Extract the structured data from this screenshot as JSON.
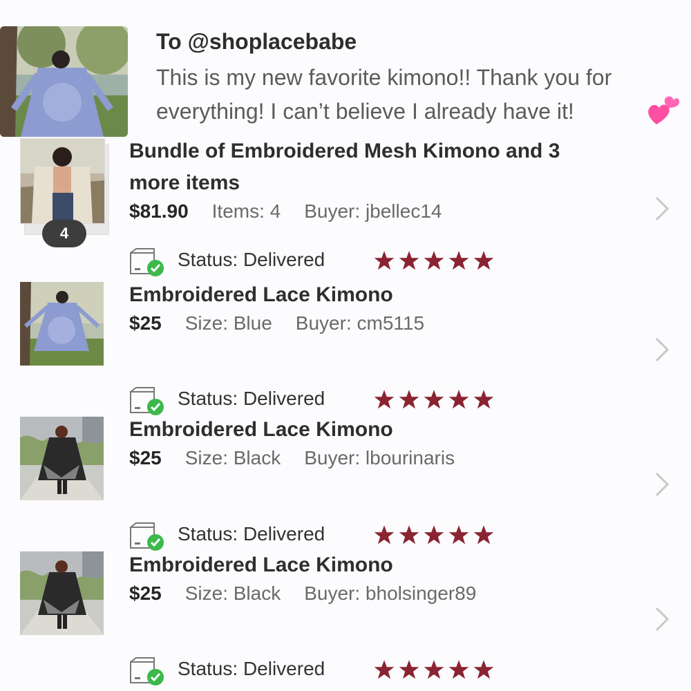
{
  "review": {
    "to": "To @shoplacebabe",
    "text": "This is my new favorite kimono!! Thank you for everything! I can’t believe I already have it!"
  },
  "orders": [
    {
      "title_line1": "Bundle of Embroidered Mesh Kimono and 3",
      "title_line2": "more items",
      "price": "$81.90",
      "detail": "Items: 4",
      "buyer": "Buyer: jbellec14",
      "count_badge": "4"
    },
    {
      "status_label": "Status:  Delivered",
      "title": "Embroidered Lace Kimono",
      "price": "$25",
      "detail": "Size: Blue",
      "buyer": "Buyer: cm5115"
    },
    {
      "status_label": "Status:  Delivered",
      "title": "Embroidered Lace Kimono",
      "price": "$25",
      "detail": "Size: Black",
      "buyer": "Buyer: lbourinaris"
    },
    {
      "status_label": "Status:  Delivered",
      "title": "Embroidered Lace Kimono",
      "price": "$25",
      "detail": "Size: Black",
      "buyer": "Buyer: bholsinger89"
    }
  ],
  "bundle_status": {
    "status_label": "Status:  Delivered"
  },
  "last_status": {
    "status_label": "Status:  Delivered"
  },
  "rating": {
    "stars": 5,
    "max": 5
  },
  "colors": {
    "star": "#8a2432",
    "check": "#3cb94a",
    "chevron": "#c8c8c8",
    "badge_bg": "#3d3d3d"
  },
  "icons": {
    "chevron": "chevron-right-icon",
    "status": "delivered-box-icon",
    "star": "star-icon",
    "heart": "sparkling-heart-icon"
  }
}
